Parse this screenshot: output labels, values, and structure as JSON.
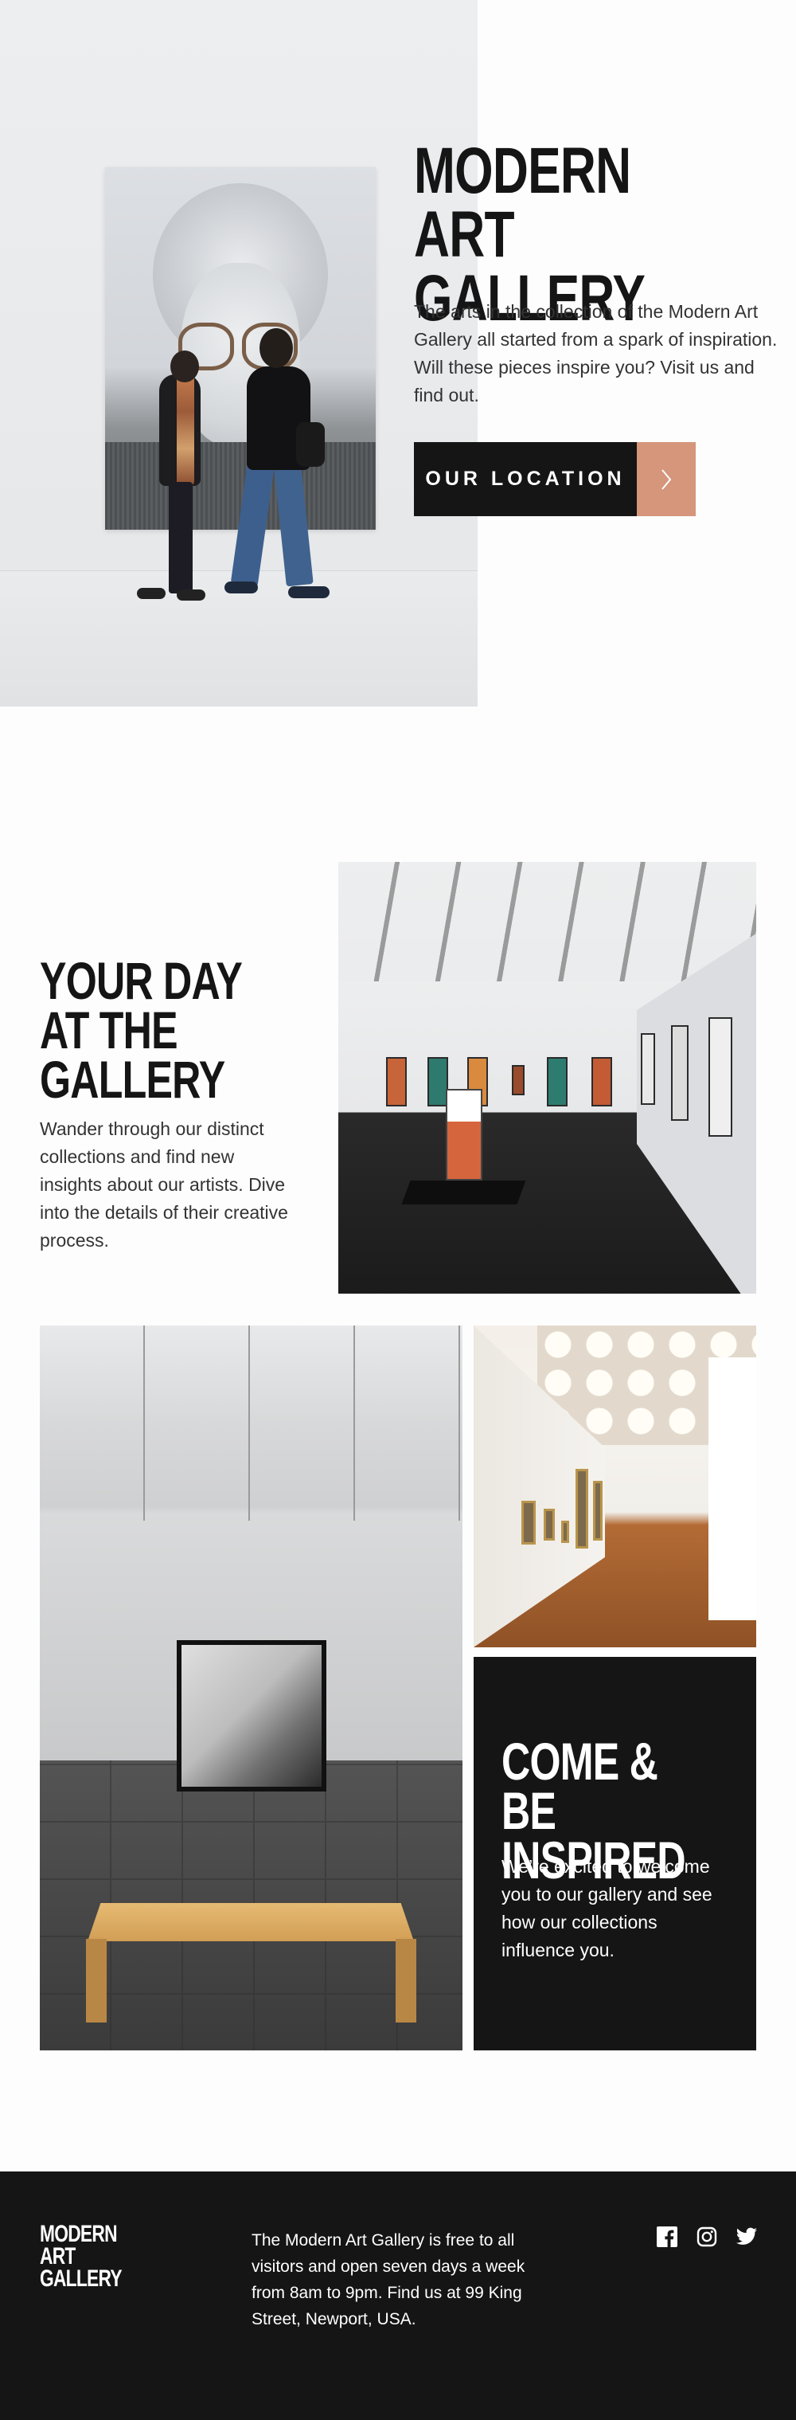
{
  "hero": {
    "title": "MODERN\nART GALLERY",
    "description": "The arts in the collection of the Modern Art Gallery all started from a spark of inspiration. Will these pieces inspire you? Visit us and find out.",
    "button_label": "OUR LOCATION",
    "arrow_icon": "chevron-right-icon"
  },
  "day": {
    "title": "YOUR DAY\nAT THE\nGALLERY",
    "description": "Wander through our distinct collections and find new insights about our artists. Dive into the details of their creative process."
  },
  "inspire": {
    "title": "COME & BE\nINSPIRED",
    "description": "We’re excited to welcome you to our gallery and see how our collections influence you."
  },
  "footer": {
    "logo": "MODERN\nART GALLERY",
    "description": "The Modern Art Gallery is free to all visitors and open seven days a week from 8am to 9pm. Find us at 99 King Street, Newport, USA.",
    "social_icons": [
      "facebook-icon",
      "instagram-icon",
      "twitter-icon"
    ]
  },
  "colors": {
    "dark": "#151515",
    "accent": "#d5967b",
    "light": "#fdfdfd",
    "text_gray": "#333333"
  }
}
